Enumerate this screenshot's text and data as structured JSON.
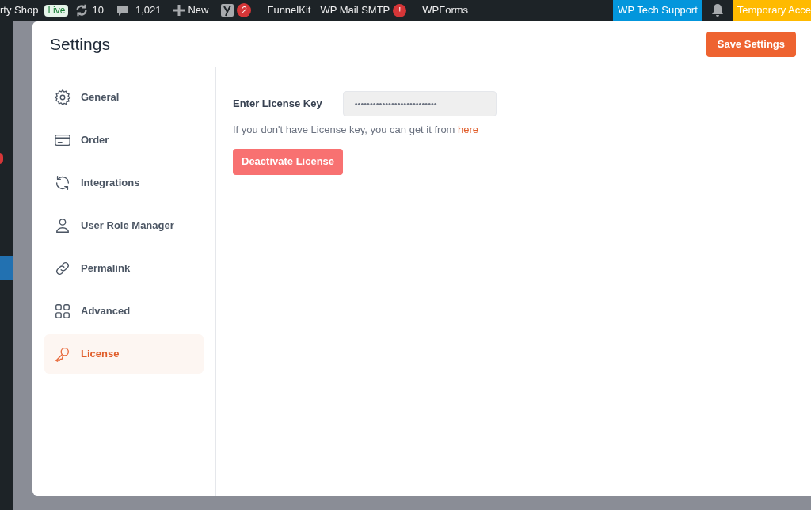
{
  "admin_bar": {
    "site_name": "rty Shop",
    "site_badge": "Live",
    "updates": "10",
    "comments": "1,021",
    "new": "New",
    "seo_badge": "2",
    "links": [
      {
        "label": "FunnelKit"
      },
      {
        "label": "WP Mail SMTP",
        "badge": "!"
      },
      {
        "label": "WPForms"
      }
    ],
    "support": "WP Tech Support",
    "temporary_access": "Temporary Acce"
  },
  "modal": {
    "title": "Settings",
    "save_button": "Save Settings",
    "nav": [
      {
        "label": "General",
        "kind": "gear",
        "selected": false
      },
      {
        "label": "Order",
        "kind": "card",
        "selected": false
      },
      {
        "label": "Integrations",
        "kind": "sync",
        "selected": false
      },
      {
        "label": "User Role Manager",
        "kind": "user",
        "selected": false
      },
      {
        "label": "Permalink",
        "kind": "link",
        "selected": false
      },
      {
        "label": "Advanced",
        "kind": "grid",
        "selected": false
      },
      {
        "label": "License",
        "kind": "key",
        "selected": true
      }
    ],
    "license": {
      "label": "Enter License Key",
      "value": "•••••••••••••••••••••••••••",
      "help": "If you don't have License key, you can get it from",
      "help_link": "here",
      "button": "Deactivate License"
    }
  }
}
